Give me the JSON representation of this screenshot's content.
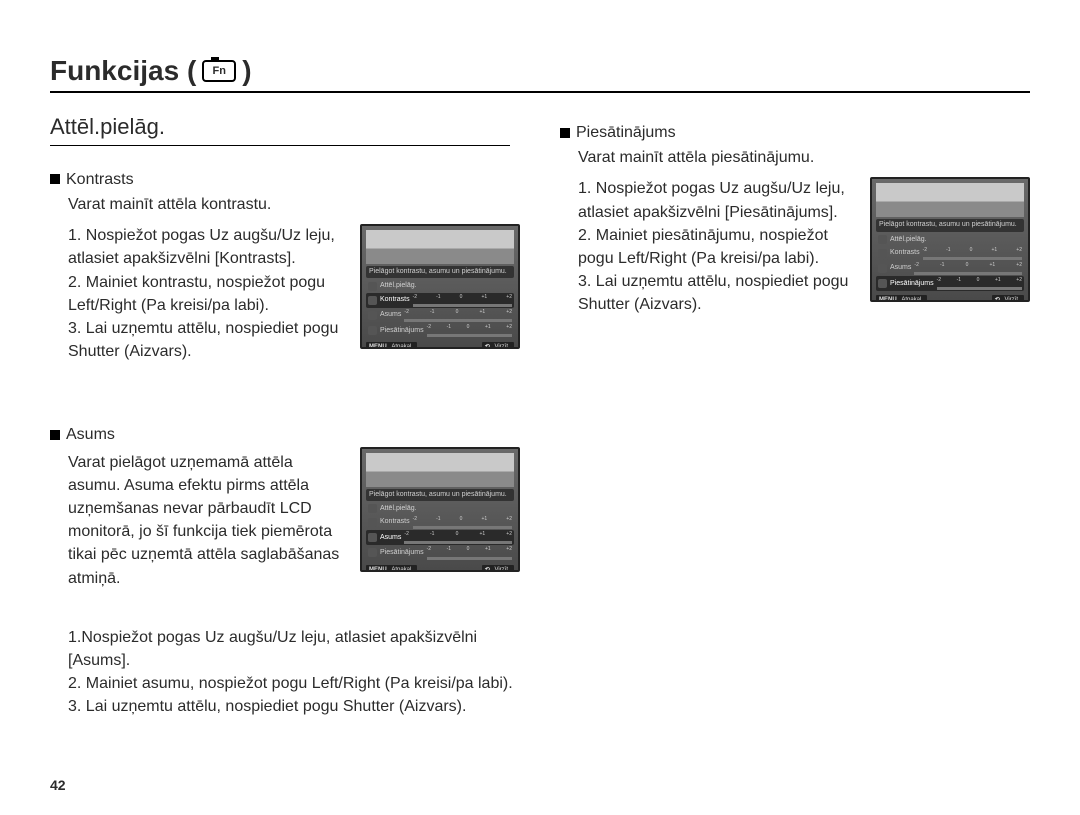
{
  "page": {
    "title_prefix": "Funkcijas (",
    "title_glyph": "Fn",
    "title_suffix": ")",
    "section": "Attēl.pielāg.",
    "number": "42"
  },
  "left": {
    "contrast": {
      "heading": "Kontrasts",
      "desc": "Varat mainīt attēla kontrastu.",
      "steps": [
        "1. Nospiežot pogas Uz augšu/Uz leju, atlasiet apakšizvēlni [Kontrasts].",
        "2. Mainiet kontrastu, nospiežot pogu Left/Right (Pa kreisi/pa labi).",
        "3. Lai uzņemtu attēlu, nospiediet pogu Shutter (Aizvars)."
      ]
    },
    "sharpness": {
      "heading": "Asums",
      "desc": "Varat pielāgot uzņemamā attēla asumu. Asuma efektu pirms attēla uzņemšanas nevar pārbaudīt LCD monitorā, jo šī funkcija tiek piemērota tikai pēc uzņemtā attēla saglabāšanas atmiņā.",
      "steps": [
        "1.Nospiežot pogas Uz augšu/Uz leju, atlasiet apakšizvēlni [Asums].",
        "2. Mainiet asumu, nospiežot pogu Left/Right (Pa kreisi/pa labi).",
        "3. Lai uzņemtu attēlu, nospiediet pogu Shutter (Aizvars)."
      ]
    }
  },
  "right": {
    "saturation": {
      "heading": "Piesātinājums",
      "desc": "Varat mainīt attēla piesātinājumu.",
      "steps": [
        "1. Nospiežot pogas Uz augšu/Uz leju, atlasiet apakšizvēlni [Piesātinājums].",
        "2. Mainiet piesātinājumu, nospiežot pogu Left/Right (Pa kreisi/pa labi).",
        "3. Lai uzņemtu attēlu, nospiediet pogu Shutter (Aizvars)."
      ]
    }
  },
  "screen": {
    "hint": "Pielāgot kontrastu, asumu un piesātinājumu.",
    "menu_title": "Attēl.pielāg.",
    "rows": {
      "contrast": "Kontrasts",
      "sharpness": "Asums",
      "saturation": "Piesātinājums"
    },
    "scale": [
      "-2",
      "-1",
      "0",
      "+1",
      "+2"
    ],
    "nav_back_btn": "MENU",
    "nav_back": "Atpakaļ",
    "nav_move_btn": "⟲",
    "nav_move": "Virzīt"
  }
}
